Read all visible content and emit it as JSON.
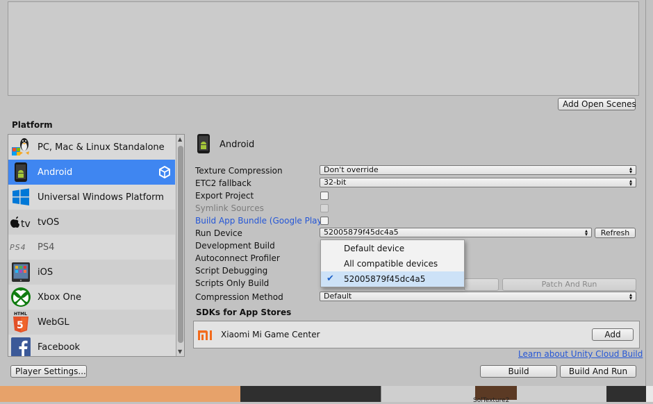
{
  "scenes": {
    "add_open_scenes": "Add Open Scenes"
  },
  "platform": {
    "title": "Platform",
    "items": [
      {
        "label": "PC, Mac & Linux Standalone",
        "icon": "pc-mac-linux-icon"
      },
      {
        "label": "Android",
        "icon": "android-icon",
        "selected": true
      },
      {
        "label": "Universal Windows Platform",
        "icon": "windows-icon"
      },
      {
        "label": "tvOS",
        "icon": "apple-tv-icon"
      },
      {
        "label": "PS4",
        "icon": "ps4-icon"
      },
      {
        "label": "iOS",
        "icon": "ios-device-icon"
      },
      {
        "label": "Xbox One",
        "icon": "xbox-icon"
      },
      {
        "label": "WebGL",
        "icon": "html5-icon"
      },
      {
        "label": "Facebook",
        "icon": "facebook-icon"
      }
    ]
  },
  "settings": {
    "platform_name": "Android",
    "texture_compression": {
      "label": "Texture Compression",
      "value": "Don't override"
    },
    "etc2_fallback": {
      "label": "ETC2 fallback",
      "value": "32-bit"
    },
    "export_project": {
      "label": "Export Project",
      "checked": false
    },
    "symlink_sources": {
      "label": "Symlink Sources",
      "checked": false,
      "disabled": true
    },
    "build_app_bundle": {
      "label": "Build App Bundle (Google Play)",
      "checked": false
    },
    "run_device": {
      "label": "Run Device",
      "value": "52005879f45dc4a5",
      "refresh": "Refresh"
    },
    "development_build": {
      "label": "Development Build"
    },
    "autoconnect_profiler": {
      "label": "Autoconnect Profiler"
    },
    "script_debugging": {
      "label": "Script Debugging"
    },
    "scripts_only_build": {
      "label": "Scripts Only Build",
      "patch_and_run": "Patch And Run"
    },
    "compression_method": {
      "label": "Compression Method",
      "value": "Default"
    }
  },
  "run_device_menu": {
    "options": [
      "Default device",
      "All compatible devices",
      "52005879f45dc4a5"
    ],
    "selected_index": 2
  },
  "sdks": {
    "title": "SDKs for App Stores",
    "items": [
      {
        "label": "Xiaomi Mi Game Center",
        "add": "Add"
      }
    ]
  },
  "footer": {
    "cloud_link": "Learn about Unity Cloud Build",
    "player_settings": "Player Settings...",
    "build": "Build",
    "build_and_run": "Build And Run"
  },
  "colors": {
    "selection": "#3f86f1",
    "link": "#2456d6",
    "window_bg": "#c2c2c2"
  }
}
